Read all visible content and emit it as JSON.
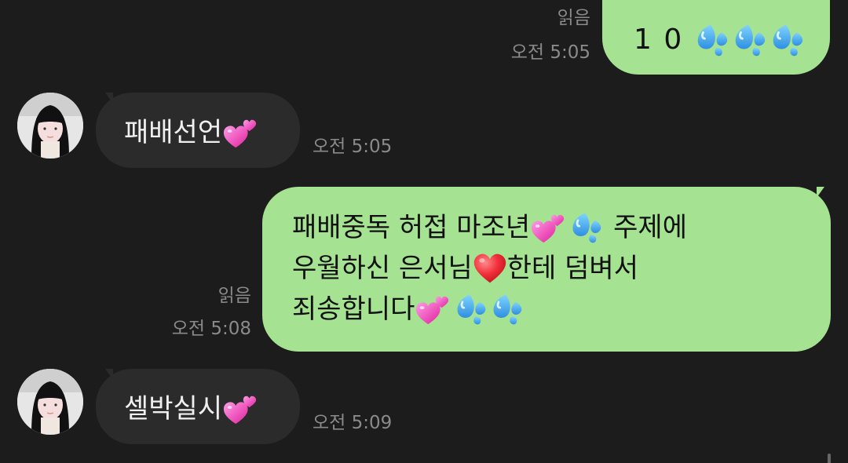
{
  "messages": [
    {
      "id": "m1",
      "direction": "outgoing",
      "text": "1 0",
      "read_label": "읽음",
      "time": "오전 5:05",
      "emojis": [
        "sweat-droplets",
        "sweat-droplets",
        "sweat-droplets"
      ]
    },
    {
      "id": "m2",
      "direction": "incoming",
      "text": "패배선언",
      "time": "오전 5:05",
      "emojis": [
        "two-hearts"
      ]
    },
    {
      "id": "m3",
      "direction": "outgoing",
      "lines": [
        {
          "a": "패배중독 허접 마조년",
          "b": "주제에"
        },
        {
          "a": "우월하신 은서님",
          "b": "한테 덤벼서"
        },
        {
          "a": "죄송합니다",
          "b": ""
        }
      ],
      "read_label": "읽음",
      "time": "오전 5:08",
      "emojis": [
        "two-hearts",
        "sweat-droplets",
        "red-heart",
        "two-hearts",
        "sweat-droplets",
        "sweat-droplets"
      ]
    },
    {
      "id": "m4",
      "direction": "incoming",
      "text": "셀박실시",
      "time": "오전 5:09",
      "emojis": [
        "two-hearts"
      ]
    }
  ],
  "colors": {
    "background": "#1c1c1c",
    "outgoing_bubble": "#a5e291",
    "incoming_bubble": "#2b2b2b",
    "meta_text": "#8a8a8a"
  },
  "icons": {
    "sweat": "sweat-droplets-icon",
    "hearts": "two-hearts-icon",
    "heart": "red-heart-icon",
    "avatar": "profile-avatar"
  }
}
